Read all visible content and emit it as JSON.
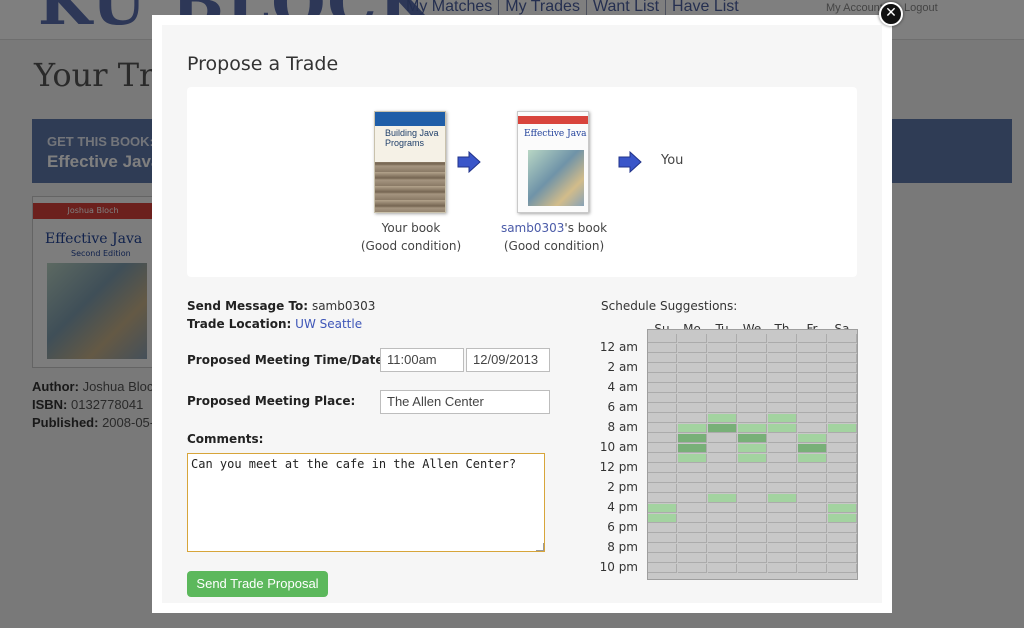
{
  "background": {
    "logo": "KU BLOCK",
    "nav": [
      "My Matches",
      "My Trades",
      "Want List",
      "Have List"
    ],
    "account": "My Account",
    "logout": "Logout",
    "page_title": "Your Tr",
    "banner_kicker": "GET THIS BOOK:",
    "banner_title": "Effective Java",
    "cover_author": "Joshua Bloch",
    "cover_title": "Effective Java",
    "cover_subtitle": "Second Edition",
    "meta": {
      "author_label": "Author:",
      "author_value": "Joshua Bloch",
      "isbn_label": "ISBN:",
      "isbn_value": "0132778041",
      "published_label": "Published:",
      "published_value": "2008-05-"
    }
  },
  "modal": {
    "close_label": "✕",
    "title": "Propose a Trade",
    "flow": {
      "your_book": {
        "cover_title": "Building Java Programs",
        "label_line1": "Your book",
        "label_line2": "(Good condition)"
      },
      "their_book": {
        "cover_title": "Effective Java",
        "owner": "samb0303",
        "owner_suffix": "'s book",
        "label_line2": "(Good condition)"
      },
      "you_label": "You",
      "arrow_color": "#3a56c9"
    },
    "send_to_label": "Send Message To:",
    "send_to_value": "samb0303",
    "location_label": "Trade Location:",
    "location_value": "UW Seattle",
    "time_label": "Proposed Meeting Time/Date:",
    "time_value": "11:00am",
    "date_value": "12/09/2013",
    "place_label": "Proposed Meeting Place:",
    "place_value": "The Allen Center",
    "comments_label": "Comments:",
    "comments_value": "Can you meet at the cafe in the Allen Center?",
    "send_button": "Send Trade Proposal",
    "accent_color": "#5cb85c"
  },
  "schedule": {
    "title": "Schedule Suggestions:",
    "days": [
      "Su",
      "Mo",
      "Tu",
      "We",
      "Th",
      "Fr",
      "Sa"
    ],
    "time_labels": [
      "12 am",
      "2 am",
      "4 am",
      "6 am",
      "8 am",
      "10 am",
      "12 pm",
      "2 pm",
      "4 pm",
      "6 pm",
      "8 pm",
      "10 pm"
    ],
    "slots_per_day": 24,
    "slot_minutes": 60,
    "colors": {
      "empty": "#c8c8c8",
      "light": "#a3d3a0",
      "dark": "#78b078",
      "line": "#ababab"
    },
    "highlights": {
      "Su": {
        "light": [
          17,
          18
        ],
        "dark": []
      },
      "Mo": {
        "light": [
          9,
          12
        ],
        "dark": [
          10,
          11
        ]
      },
      "Tu": {
        "light": [
          8,
          16
        ],
        "dark": [
          9
        ]
      },
      "We": {
        "light": [
          9,
          11,
          12
        ],
        "dark": [
          10
        ]
      },
      "Th": {
        "light": [
          8,
          9,
          16
        ],
        "dark": []
      },
      "Fr": {
        "light": [
          10,
          12
        ],
        "dark": [
          11
        ]
      },
      "Sa": {
        "light": [
          9,
          17,
          18
        ],
        "dark": []
      }
    }
  }
}
